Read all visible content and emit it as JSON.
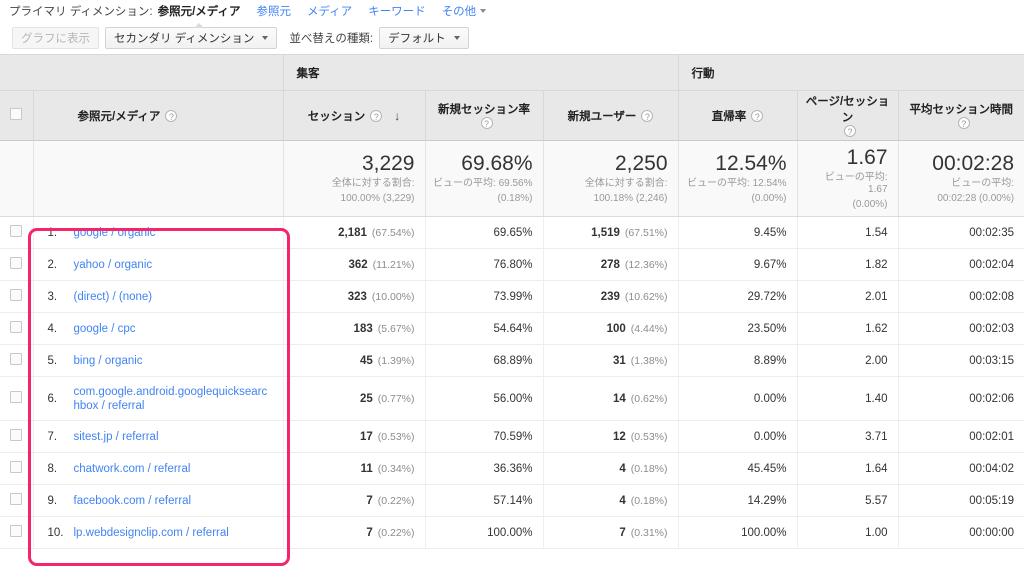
{
  "primary_dimension": {
    "label": "プライマリ ディメンション:",
    "active": "参照元/メディア",
    "links": [
      "参照元",
      "メディア",
      "キーワード"
    ],
    "more": "その他"
  },
  "toolbar": {
    "plot_rows_label": "グラフに表示",
    "secondary_dimension_label": "セカンダリ ディメンション",
    "sort_type_label": "並べ替えの種類:",
    "sort_type_value": "デフォルト"
  },
  "table": {
    "group_headers": [
      {
        "label": "集客"
      },
      {
        "label": "行動"
      }
    ],
    "dimension_header": "参照元/メディア",
    "columns": [
      {
        "label": "セッション",
        "help": "?",
        "sorted": true,
        "sort_icon": "↓"
      },
      {
        "label": "新規セッション率",
        "help": "?"
      },
      {
        "label": "新規ユーザー",
        "help": "?"
      },
      {
        "label": "直帰率",
        "help": "?"
      },
      {
        "label": "ページ/セッション",
        "help": "?"
      },
      {
        "label": "平均セッション時間",
        "help": "?"
      }
    ],
    "summary": [
      {
        "big": "3,229",
        "sub1": "全体に対する割合:",
        "sub2": "100.00% (3,229)"
      },
      {
        "big": "69.68%",
        "sub1": "ビューの平均: 69.56%",
        "sub2": "(0.18%)"
      },
      {
        "big": "2,250",
        "sub1": "全体に対する割合:",
        "sub2": "100.18% (2,246)"
      },
      {
        "big": "12.54%",
        "sub1": "ビューの平均: 12.54%",
        "sub2": "(0.00%)"
      },
      {
        "big": "1.67",
        "sub1": "ビューの平均: 1.67",
        "sub2": "(0.00%)"
      },
      {
        "big": "00:02:28",
        "sub1": "ビューの平均:",
        "sub2": "00:02:28 (0.00%)"
      }
    ],
    "rows": [
      {
        "num": "1.",
        "name": "google / organic",
        "sessions": "2,181",
        "sessions_pct": "(67.54%)",
        "new_session_rate": "69.65%",
        "new_users": "1,519",
        "new_users_pct": "(67.51%)",
        "bounce_rate": "9.45%",
        "pages_per_session": "1.54",
        "avg_duration": "00:02:35"
      },
      {
        "num": "2.",
        "name": "yahoo / organic",
        "sessions": "362",
        "sessions_pct": "(11.21%)",
        "new_session_rate": "76.80%",
        "new_users": "278",
        "new_users_pct": "(12.36%)",
        "bounce_rate": "9.67%",
        "pages_per_session": "1.82",
        "avg_duration": "00:02:04"
      },
      {
        "num": "3.",
        "name": "(direct) / (none)",
        "sessions": "323",
        "sessions_pct": "(10.00%)",
        "new_session_rate": "73.99%",
        "new_users": "239",
        "new_users_pct": "(10.62%)",
        "bounce_rate": "29.72%",
        "pages_per_session": "2.01",
        "avg_duration": "00:02:08"
      },
      {
        "num": "4.",
        "name": "google / cpc",
        "sessions": "183",
        "sessions_pct": "(5.67%)",
        "new_session_rate": "54.64%",
        "new_users": "100",
        "new_users_pct": "(4.44%)",
        "bounce_rate": "23.50%",
        "pages_per_session": "1.62",
        "avg_duration": "00:02:03"
      },
      {
        "num": "5.",
        "name": "bing / organic",
        "sessions": "45",
        "sessions_pct": "(1.39%)",
        "new_session_rate": "68.89%",
        "new_users": "31",
        "new_users_pct": "(1.38%)",
        "bounce_rate": "8.89%",
        "pages_per_session": "2.00",
        "avg_duration": "00:03:15"
      },
      {
        "num": "6.",
        "name": "com.google.android.googlequicksearchbox / referral",
        "sessions": "25",
        "sessions_pct": "(0.77%)",
        "new_session_rate": "56.00%",
        "new_users": "14",
        "new_users_pct": "(0.62%)",
        "bounce_rate": "0.00%",
        "pages_per_session": "1.40",
        "avg_duration": "00:02:06",
        "tall": true
      },
      {
        "num": "7.",
        "name": "sitest.jp / referral",
        "sessions": "17",
        "sessions_pct": "(0.53%)",
        "new_session_rate": "70.59%",
        "new_users": "12",
        "new_users_pct": "(0.53%)",
        "bounce_rate": "0.00%",
        "pages_per_session": "3.71",
        "avg_duration": "00:02:01"
      },
      {
        "num": "8.",
        "name": "chatwork.com / referral",
        "sessions": "11",
        "sessions_pct": "(0.34%)",
        "new_session_rate": "36.36%",
        "new_users": "4",
        "new_users_pct": "(0.18%)",
        "bounce_rate": "45.45%",
        "pages_per_session": "1.64",
        "avg_duration": "00:04:02"
      },
      {
        "num": "9.",
        "name": "facebook.com / referral",
        "sessions": "7",
        "sessions_pct": "(0.22%)",
        "new_session_rate": "57.14%",
        "new_users": "4",
        "new_users_pct": "(0.18%)",
        "bounce_rate": "14.29%",
        "pages_per_session": "5.57",
        "avg_duration": "00:05:19"
      },
      {
        "num": "10.",
        "name": "lp.webdesignclip.com / referral",
        "sessions": "7",
        "sessions_pct": "(0.22%)",
        "new_session_rate": "100.00%",
        "new_users": "7",
        "new_users_pct": "(0.31%)",
        "bounce_rate": "100.00%",
        "pages_per_session": "1.00",
        "avg_duration": "00:00:00"
      }
    ]
  },
  "annotation": {
    "highlight_color": "#f4256b"
  }
}
